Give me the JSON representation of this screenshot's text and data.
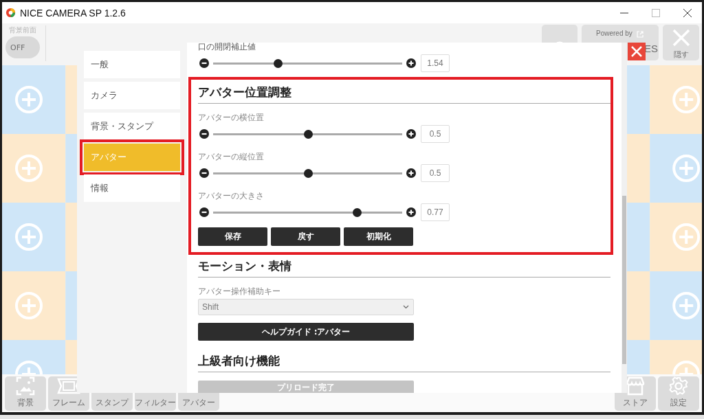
{
  "window": {
    "title": "NICE CAMERA SP 1.2.6"
  },
  "top_bar": {
    "toggle": {
      "label": "背景前面",
      "state_text": "OFF",
      "on": false
    },
    "powered_by": "Powered by",
    "brand_fragment": "ES",
    "hide_button": "隠す"
  },
  "toolbar": {
    "left": [
      {
        "kind": "background",
        "label": "背景"
      },
      {
        "kind": "frame",
        "label": "フレーム"
      },
      {
        "kind": "stamp",
        "label": "スタンプ"
      },
      {
        "kind": "filter",
        "label": "フィルター"
      },
      {
        "kind": "avatar",
        "label": "アバター"
      }
    ],
    "right": [
      {
        "kind": "store",
        "label": "ストア"
      },
      {
        "kind": "settings",
        "label": "設定"
      }
    ]
  },
  "dialog": {
    "nav": [
      {
        "label": "一般",
        "selected": false,
        "highlighted": false
      },
      {
        "label": "カメラ",
        "selected": false,
        "highlighted": false
      },
      {
        "label": "背景・スタンプ",
        "selected": false,
        "highlighted": false
      },
      {
        "label": "アバター",
        "selected": true,
        "highlighted": true
      },
      {
        "label": "情報",
        "selected": false,
        "highlighted": false
      }
    ],
    "sections": [
      {
        "highlighted": false,
        "items": [
          {
            "kind": "slider",
            "label": "口の開閉補止値",
            "level": 0.34,
            "reading": "1.54"
          }
        ]
      },
      {
        "title": "アバター位置調整",
        "highlighted": true,
        "items": [
          {
            "kind": "slider",
            "label": "アバターの横位置",
            "level": 0.5,
            "reading": "0.5"
          },
          {
            "kind": "slider",
            "label": "アバターの縦位置",
            "level": 0.5,
            "reading": "0.5"
          },
          {
            "kind": "slider",
            "label": "アバターの大きさ",
            "level": 0.76,
            "reading": "0.77"
          },
          {
            "kind": "button_row",
            "buttons": [
              "保存",
              "戻す",
              "初期化"
            ]
          }
        ]
      },
      {
        "title": "モーション・表情",
        "highlighted": false,
        "items": [
          {
            "kind": "select",
            "label": "アバター操作補助キー",
            "value": "Shift"
          },
          {
            "kind": "button",
            "label": "ヘルプガイド :アバター",
            "disabled": false
          }
        ]
      },
      {
        "title": "上級者向け機能",
        "highlighted": false,
        "items": [
          {
            "kind": "button",
            "label": "プリロード完了",
            "disabled": true
          }
        ]
      }
    ]
  }
}
